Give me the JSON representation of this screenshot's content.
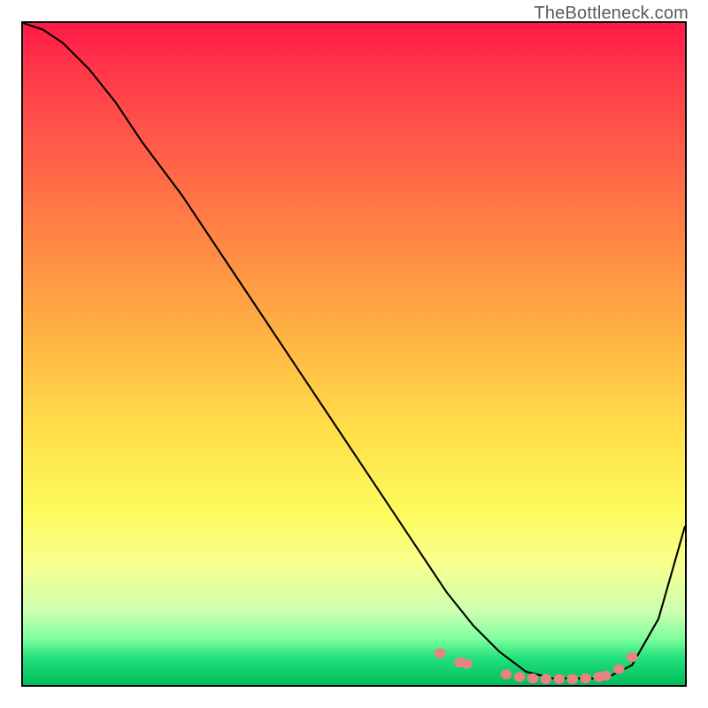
{
  "watermark": "TheBottleneck.com",
  "chart_data": {
    "type": "line",
    "title": "",
    "xlabel": "",
    "ylabel": "",
    "xlim": [
      0,
      100
    ],
    "ylim": [
      0,
      100
    ],
    "grid": false,
    "series": [
      {
        "name": "curve",
        "x": [
          0,
          3,
          6,
          10,
          14,
          18,
          24,
          30,
          36,
          42,
          48,
          54,
          60,
          64,
          68,
          72,
          76,
          80,
          84,
          88,
          92,
          96,
          100
        ],
        "values": [
          100,
          99,
          97,
          93,
          88,
          82,
          74,
          65,
          56,
          47,
          38,
          29,
          20,
          14,
          9,
          5,
          2,
          1,
          1,
          1,
          3,
          10,
          24
        ]
      }
    ],
    "markers": {
      "name": "highlight-points",
      "color": "#e98383",
      "x": [
        63,
        66,
        67,
        73,
        75,
        77,
        79,
        81,
        83,
        85,
        87,
        88,
        90,
        92
      ],
      "values": [
        4.8,
        3.4,
        3.2,
        1.6,
        1.2,
        1.0,
        0.9,
        0.9,
        0.9,
        1.0,
        1.2,
        1.4,
        2.4,
        4.2
      ]
    }
  }
}
